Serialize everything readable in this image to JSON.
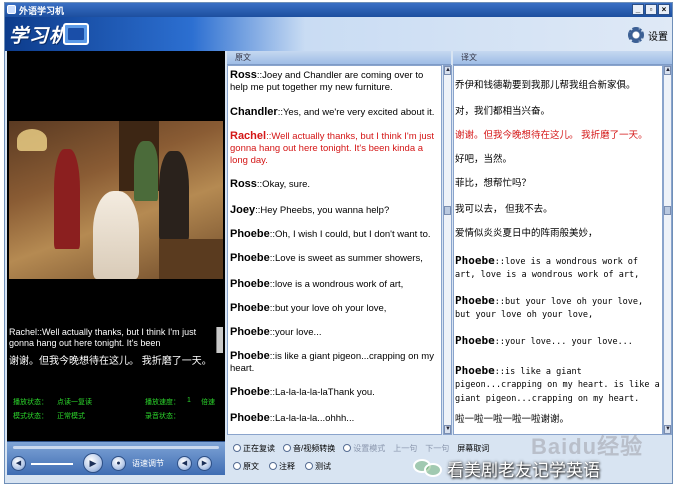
{
  "window": {
    "title": "外语学习机",
    "btn_min": "_",
    "btn_restore": "▫",
    "btn_close": "×"
  },
  "header": {
    "logo": "学习机",
    "settings_label": "设置"
  },
  "video": {
    "subtitle_en": "Rachel::Well actually thanks, but I think I'm just gonna hang out here tonight. It's been",
    "subtitle_cn": "谢谢。但我今晚想待在这儿。 我折磨了一天。",
    "status": {
      "play_label": "播放状态：",
      "play_value": "点读一复读",
      "speed_label": "播放速度：",
      "speed_value": "1",
      "speed_unit": "倍速",
      "mode_label": "模式状态：",
      "mode_value": "正常模式",
      "record_label": "录音状态："
    }
  },
  "panels": {
    "original_header": "原文",
    "translation_header": "译文"
  },
  "english_lines": [
    {
      "speaker": "Ross",
      "text": "::Joey and Chandler are coming over to help me put together my new furniture.",
      "highlight": false
    },
    {
      "speaker": "Chandler",
      "text": "::Yes, and we're very excited about it.",
      "highlight": false
    },
    {
      "speaker": "Rachel",
      "text": "::Well actually thanks, but I think I'm just gonna hang out here tonight. It's been kinda a long day.",
      "highlight": true
    },
    {
      "speaker": "Ross",
      "text": "::Okay, sure.",
      "highlight": false
    },
    {
      "speaker": "Joey",
      "text": "::Hey Pheebs, you wanna help?",
      "highlight": false
    },
    {
      "speaker": "Phoebe",
      "text": "::Oh, I wish I could, but I don't want to.",
      "highlight": false
    },
    {
      "speaker": "Phoebe",
      "text": "::Love is sweet as summer showers,",
      "highlight": false
    },
    {
      "speaker": "Phoebe",
      "text": "::love is a wondrous work of art,",
      "highlight": false
    },
    {
      "speaker": "Phoebe",
      "text": "::but your love oh your love,",
      "highlight": false
    },
    {
      "speaker": "Phoebe",
      "text": "::your love...",
      "highlight": false
    },
    {
      "speaker": "Phoebe",
      "text": "::is like a giant pigeon...crapping on my heart.",
      "highlight": false
    },
    {
      "speaker": "Phoebe",
      "text": "::La-la-la-la-laThank you.",
      "highlight": false
    },
    {
      "speaker": "Phoebe",
      "text": "::La-la-la-la...ohhh...",
      "highlight": false
    }
  ],
  "chinese_lines": {
    "l1": "乔伊和钱德勒要到我那儿帮我组合新家俱。",
    "l2": "对，我们都相当兴奋。",
    "l3": "谢谢。但我今晚想待在这儿。 我折磨了一天。",
    "l4": "好吧，当然。",
    "l5": "菲比，想帮忙吗？",
    "l6": "我可以去，  但我不去。",
    "l7": "爱情似炎炎夏日中的阵雨般美妙，",
    "l8_spk": "Phoebe",
    "l8": "::love is a wondrous work of",
    "l8b": "art, love is a wondrous work of art,",
    "l9_spk": "Phoebe",
    "l9": "::but your love oh your love,",
    "l9b": "but your love oh your love,",
    "l10_spk": "Phoebe",
    "l10": "::your love... your love...",
    "l11_spk": "Phoebe",
    "l11": "::is like a giant",
    "l11b": "pigeon...crapping on my heart. is like a",
    "l11c": "giant pigeon...crapping on my heart.",
    "l12": "啦一啦一啦一啦一啦谢谢。"
  },
  "toolbar1": {
    "b1": "正在复读",
    "b2": "音/视频转换",
    "b3": "设置模式",
    "b4": "上一句",
    "b5": "下一句",
    "b6": "屏幕取词"
  },
  "toolbar2": {
    "b1": "原文",
    "b2": "注释",
    "b3": "测试"
  },
  "playbar": {
    "volume_label": "语速调节"
  },
  "watermarks": {
    "baidu": "Baidu经验",
    "wechat_text": "看美剧老友记学英语"
  }
}
